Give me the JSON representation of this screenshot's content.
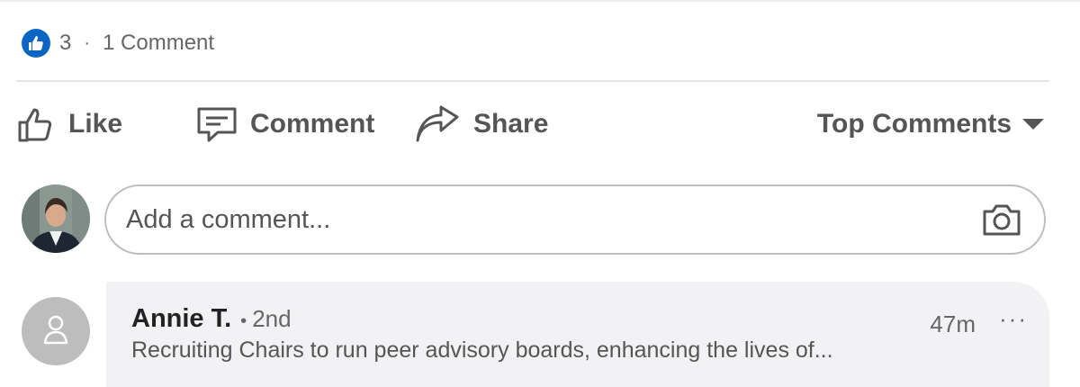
{
  "reactions": {
    "like_count": "3",
    "separator": "·",
    "comments_label": "1 Comment",
    "like_badge_icon": "thumbs-up-badge-icon",
    "badge_color": "#0a66c2"
  },
  "actions": {
    "like": {
      "label": "Like",
      "icon": "thumbs-up-outline-icon"
    },
    "comment": {
      "label": "Comment",
      "icon": "speech-bubble-icon"
    },
    "share": {
      "label": "Share",
      "icon": "share-arrow-icon"
    },
    "sort": {
      "label": "Top Comments",
      "icon": "caret-down-icon"
    }
  },
  "comment_input": {
    "placeholder": "Add a comment...",
    "value": "",
    "camera_icon": "camera-icon"
  },
  "comments": [
    {
      "author": "Annie T.",
      "separator": "•",
      "degree": "2nd",
      "time": "47m",
      "more": "···",
      "headline": "Recruiting Chairs to run peer advisory boards, enhancing the lives of...",
      "avatar_icon": "default-person-avatar-icon"
    }
  ]
}
